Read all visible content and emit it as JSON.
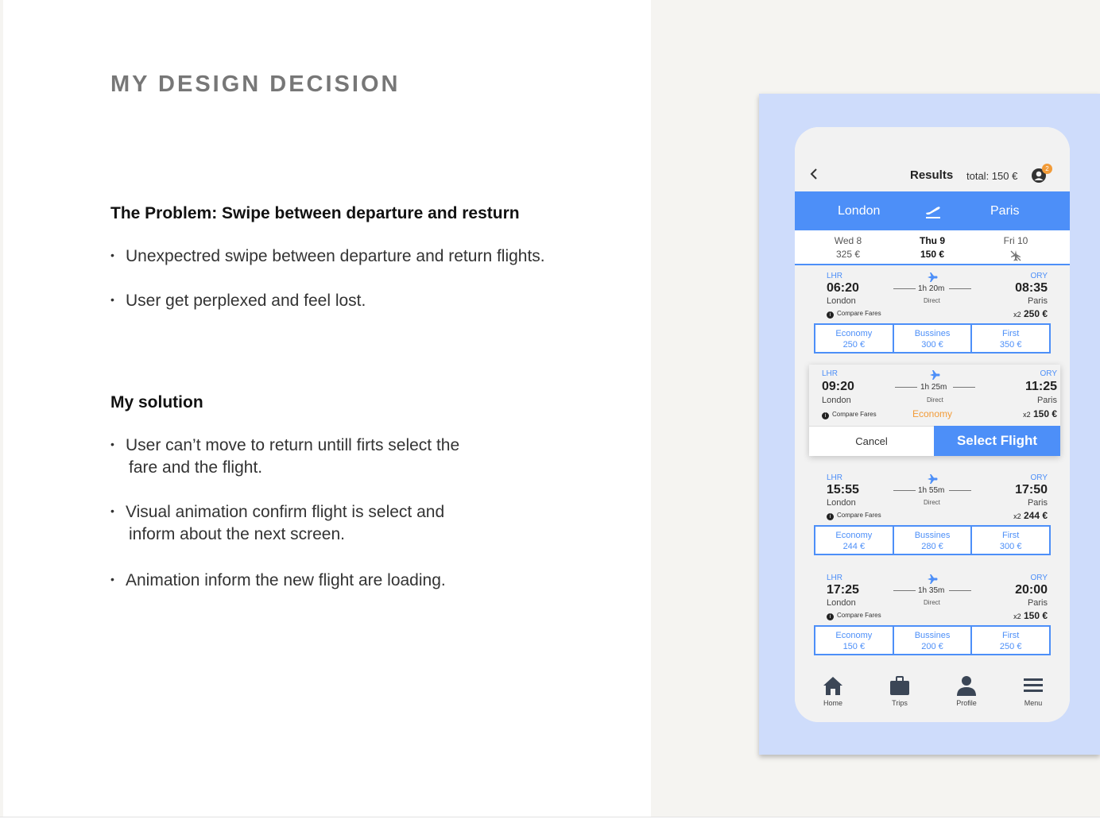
{
  "slide": {
    "title": "MY DESIGN DECISION",
    "problem_heading": "The Problem: Swipe between departure and resturn",
    "problem_bullets": [
      "Unexpectred swipe between departure and return flights.",
      "User get perplexed and feel lost."
    ],
    "solution_heading": "My solution",
    "solution_bullets": [
      {
        "line1": "User can’t move to return untill firts select the",
        "line2": "fare and the flight."
      },
      {
        "line1": "Visual animation confirm flight is select and",
        "line2": "inform about the next screen."
      },
      {
        "line1": "Animation inform the new flight are loading.",
        "line2": ""
      }
    ],
    "bullet_glyph": "•"
  },
  "app": {
    "header": {
      "title": "Results",
      "total": "total: 150 €",
      "badge": "2"
    },
    "route": {
      "from": "London",
      "to": "Paris"
    },
    "dates": [
      {
        "day": "Wed 8",
        "price": "325 €"
      },
      {
        "day": "Thu 9",
        "price": "150 €"
      },
      {
        "day": "Fri 10",
        "price": ""
      }
    ],
    "flights": [
      {
        "dep_code": "LHR",
        "dep_time": "06:20",
        "dep_city": "London",
        "duration": "1h 20m",
        "stops": "Direct",
        "arr_code": "ORY",
        "arr_time": "08:35",
        "arr_city": "Paris",
        "compare": "Compare Fares",
        "pax": "x2",
        "price": "250 €",
        "fares": [
          {
            "name": "Economy",
            "price": "250 €"
          },
          {
            "name": "Bussines",
            "price": "300 €"
          },
          {
            "name": "First",
            "price": "350 €"
          }
        ]
      },
      {
        "dep_code": "LHR",
        "dep_time": "15:55",
        "dep_city": "London",
        "duration": "1h 55m",
        "stops": "Direct",
        "arr_code": "ORY",
        "arr_time": "17:50",
        "arr_city": "Paris",
        "compare": "Compare Fares",
        "pax": "x2",
        "price": "244 €",
        "fares": [
          {
            "name": "Economy",
            "price": "244 €"
          },
          {
            "name": "Bussines",
            "price": "280 €"
          },
          {
            "name": "First",
            "price": "300 €"
          }
        ]
      },
      {
        "dep_code": "LHR",
        "dep_time": "17:25",
        "dep_city": "London",
        "duration": "1h 35m",
        "stops": "Direct",
        "arr_code": "ORY",
        "arr_time": "20:00",
        "arr_city": "Paris",
        "compare": "Compare Fares",
        "pax": "x2",
        "price": "150 €",
        "fares": [
          {
            "name": "Economy",
            "price": "150 €"
          },
          {
            "name": "Bussines",
            "price": "200 €"
          },
          {
            "name": "First",
            "price": "250 €"
          }
        ]
      }
    ],
    "selected": {
      "dep_code": "LHR",
      "dep_time": "09:20",
      "dep_city": "London",
      "duration": "1h 25m",
      "stops": "Direct",
      "arr_code": "ORY",
      "arr_time": "11:25",
      "arr_city": "Paris",
      "compare": "Compare Fares",
      "fare": "Economy",
      "pax": "x2",
      "price": "150 €",
      "cancel_label": "Cancel",
      "select_label": "Select Flight"
    },
    "tabs": [
      {
        "label": "Home",
        "icon": "home-icon"
      },
      {
        "label": "Trips",
        "icon": "briefcase-icon"
      },
      {
        "label": "Profile",
        "icon": "person-icon"
      },
      {
        "label": "Menu",
        "icon": "menu-icon"
      }
    ],
    "colors": {
      "accent": "#4d8ff8",
      "highlight": "#f29b38",
      "frame": "#cedcfb"
    }
  }
}
